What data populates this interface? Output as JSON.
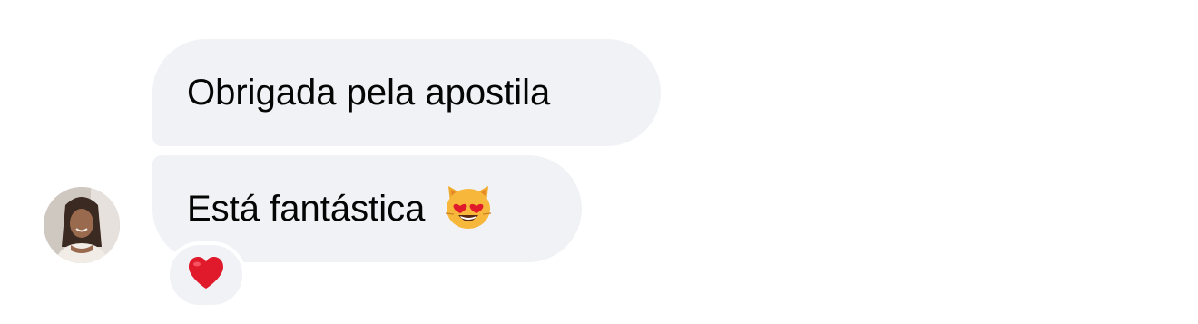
{
  "conversation": {
    "messages": [
      {
        "text": "Obrigada pela apostila",
        "emoji": null
      },
      {
        "text": "Está fantástica",
        "emoji": "smiling-cat-heart-eyes-icon"
      }
    ],
    "reaction": {
      "emoji": "red-heart-icon"
    },
    "avatar": {
      "icon": "profile-photo"
    }
  },
  "colors": {
    "bubble_bg": "#f0f2f5",
    "text": "#050505",
    "background": "#ffffff",
    "heart": "#e0192b"
  }
}
